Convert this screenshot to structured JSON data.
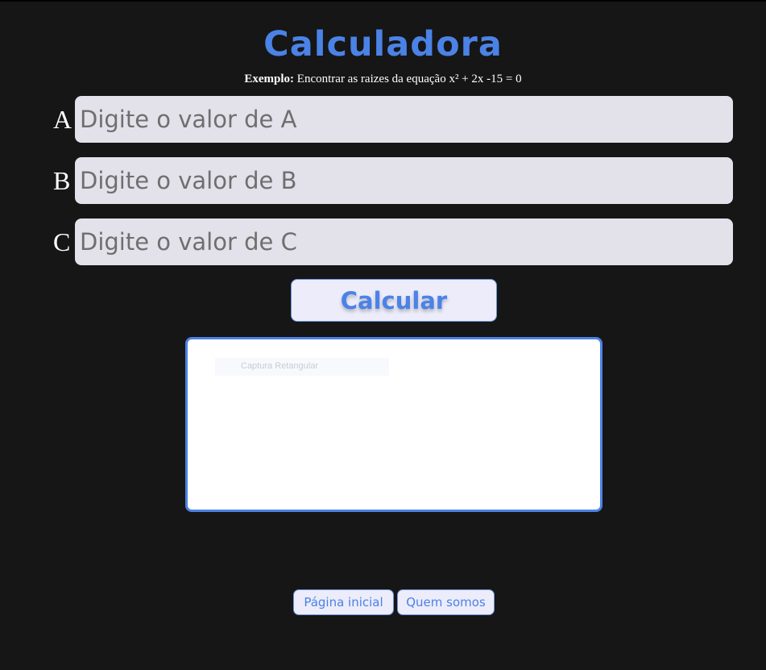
{
  "header": {
    "title": "Calculadora",
    "example_bold": "Exemplo:",
    "example_text": " Encontrar as raizes da equação x² + 2x -15 = 0"
  },
  "inputs": [
    {
      "label": "A",
      "placeholder": "Digite o valor de A",
      "value": ""
    },
    {
      "label": "B",
      "placeholder": "Digite o valor de B",
      "value": ""
    },
    {
      "label": "C",
      "placeholder": "Digite o valor de C",
      "value": ""
    }
  ],
  "calculate_label": "Calcular",
  "result": {
    "capture_text": "Captura Retangular"
  },
  "nav": {
    "home_label": "Página inicial",
    "about_label": "Quem somos"
  },
  "colors": {
    "background": "#161616",
    "accent": "#4b82e6",
    "input_bg": "#e3e2eb",
    "button_bg": "#ececfb"
  }
}
